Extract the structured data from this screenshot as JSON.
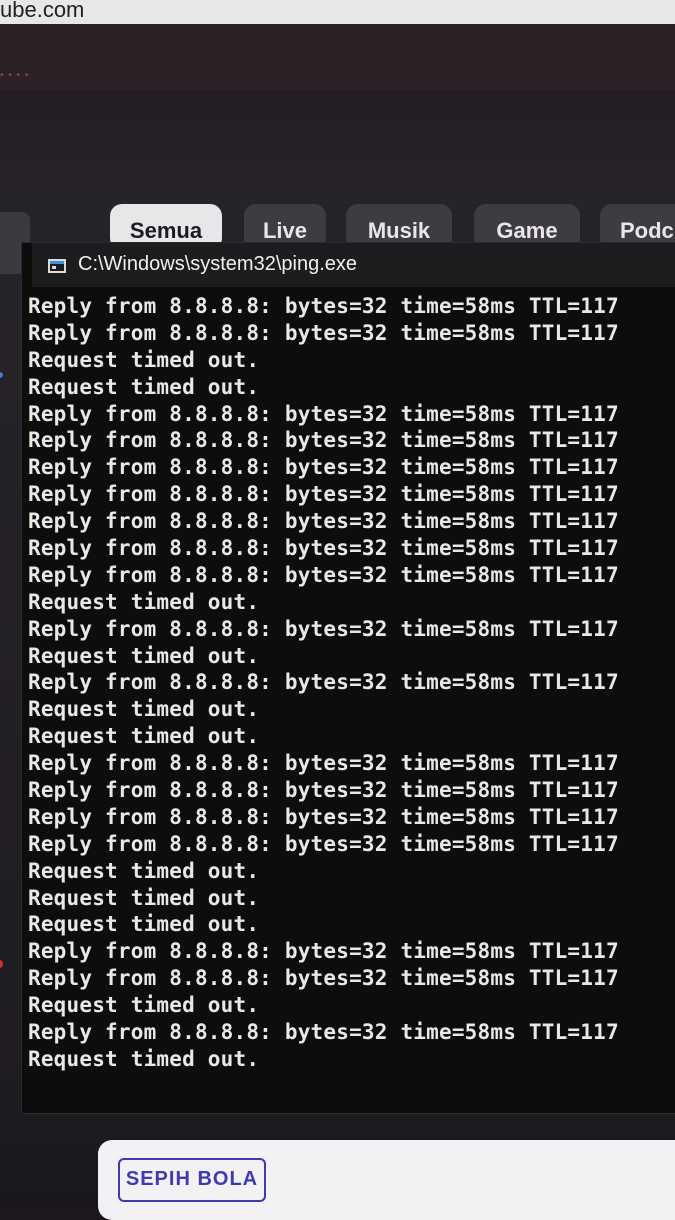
{
  "browser": {
    "url_fragment": "ube.com"
  },
  "chips": [
    "Semua",
    "Live",
    "Musik",
    "Game",
    "Podc"
  ],
  "console": {
    "title": "C:\\Windows\\system32\\ping.exe",
    "lines": [
      "Reply from 8.8.8.8: bytes=32 time=58ms TTL=117",
      "Reply from 8.8.8.8: bytes=32 time=58ms TTL=117",
      "Request timed out.",
      "Request timed out.",
      "Reply from 8.8.8.8: bytes=32 time=58ms TTL=117",
      "Reply from 8.8.8.8: bytes=32 time=58ms TTL=117",
      "Reply from 8.8.8.8: bytes=32 time=58ms TTL=117",
      "Reply from 8.8.8.8: bytes=32 time=58ms TTL=117",
      "Reply from 8.8.8.8: bytes=32 time=58ms TTL=117",
      "Reply from 8.8.8.8: bytes=32 time=58ms TTL=117",
      "Reply from 8.8.8.8: bytes=32 time=58ms TTL=117",
      "Request timed out.",
      "Reply from 8.8.8.8: bytes=32 time=58ms TTL=117",
      "Request timed out.",
      "Reply from 8.8.8.8: bytes=32 time=58ms TTL=117",
      "Request timed out.",
      "Request timed out.",
      "Reply from 8.8.8.8: bytes=32 time=58ms TTL=117",
      "Reply from 8.8.8.8: bytes=32 time=58ms TTL=117",
      "Reply from 8.8.8.8: bytes=32 time=58ms TTL=117",
      "Reply from 8.8.8.8: bytes=32 time=58ms TTL=117",
      "Request timed out.",
      "Request timed out.",
      "Request timed out.",
      "Reply from 8.8.8.8: bytes=32 time=58ms TTL=117",
      "Reply from 8.8.8.8: bytes=32 time=58ms TTL=117",
      "Request timed out.",
      "Reply from 8.8.8.8: bytes=32 time=58ms TTL=117",
      "Request timed out."
    ]
  },
  "bottom": {
    "logo_text": "SEPIH BOLA"
  },
  "colors": {
    "console_bg": "#0d0d0e",
    "console_text": "#e8e8e8",
    "active_chip_bg": "#e8e6e9",
    "chip_bg": "#3e3b41"
  }
}
